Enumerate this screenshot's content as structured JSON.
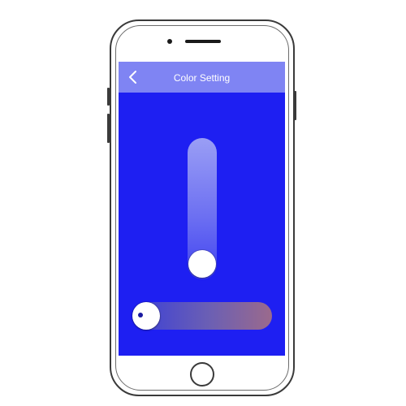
{
  "navbar": {
    "title": "Color Setting",
    "back_icon": "chevron-left-icon"
  },
  "colors": {
    "screen_background": "#1e1ff2",
    "navbar_background": "#7f84f3",
    "title_text": "#ffffff"
  },
  "brightness_slider": {
    "level": 0.0
  },
  "hue_slider": {
    "level": 0.0
  }
}
